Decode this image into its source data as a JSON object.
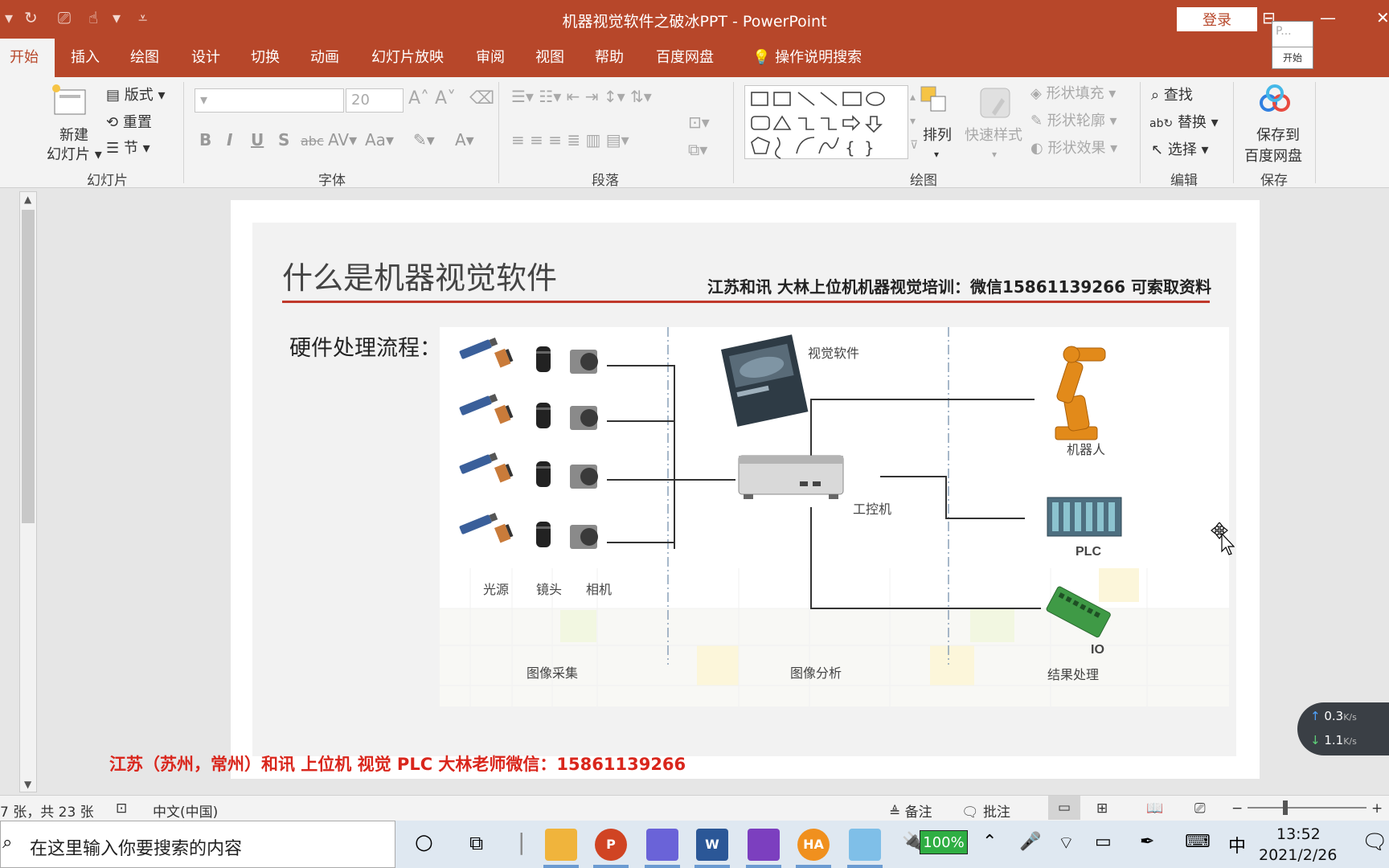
{
  "window": {
    "title": "机器视觉软件之破冰PPT  -  PowerPoint",
    "login": "登录",
    "popup_label": "开始",
    "popup_preview": "P..."
  },
  "tabs": [
    "开始",
    "插入",
    "绘图",
    "设计",
    "切换",
    "动画",
    "幻灯片放映",
    "审阅",
    "视图",
    "帮助",
    "百度网盘"
  ],
  "tell_me": "操作说明搜索",
  "ribbon": {
    "slides": {
      "new_slide": "新建",
      "new_slide2": "幻灯片",
      "layout": "版式",
      "reset": "重置",
      "section": "节",
      "label": "幻灯片"
    },
    "font": {
      "size": "20",
      "case": "Aa",
      "label": "字体"
    },
    "paragraph": {
      "label": "段落"
    },
    "drawing": {
      "arrange": "排列",
      "quick_styles": "快速样式",
      "fill": "形状填充",
      "outline": "形状轮廓",
      "effects": "形状效果",
      "label": "绘图"
    },
    "editing": {
      "find": "查找",
      "replace": "替换",
      "select": "选择",
      "label": "编辑"
    },
    "save": {
      "line1": "保存到",
      "line2": "百度网盘",
      "label": "保存"
    }
  },
  "slide": {
    "title": "什么是机器视觉软件",
    "subtitle": "江苏和讯   大林上位机机器视觉培训：微信15861139266 可索取资料",
    "hw_label": "硬件处理流程：",
    "diagram": {
      "vision_software": "视觉软件",
      "ipc": "工控机",
      "robot": "机器人",
      "plc": "PLC",
      "io": "IO",
      "light": "光源",
      "lens": "镜头",
      "camera": "相机",
      "acquire": "图像采集",
      "analyze": "图像分析",
      "result": "结果处理"
    },
    "footer": "江苏（苏州，常州）和讯 上位机  视觉  PLC 大林老师微信：15861139266"
  },
  "net": {
    "up": "0.3",
    "down": "1.1",
    "unit": "K/s"
  },
  "status": {
    "slide_count": "7 张，共 23 张",
    "language": "中文(中国)",
    "notes": "备注",
    "comments": "批注"
  },
  "taskbar": {
    "search_placeholder": "在这里输入你要搜索的内容",
    "battery": "100%",
    "ime": "中",
    "time": "13:52",
    "date": "2021/2/26"
  }
}
